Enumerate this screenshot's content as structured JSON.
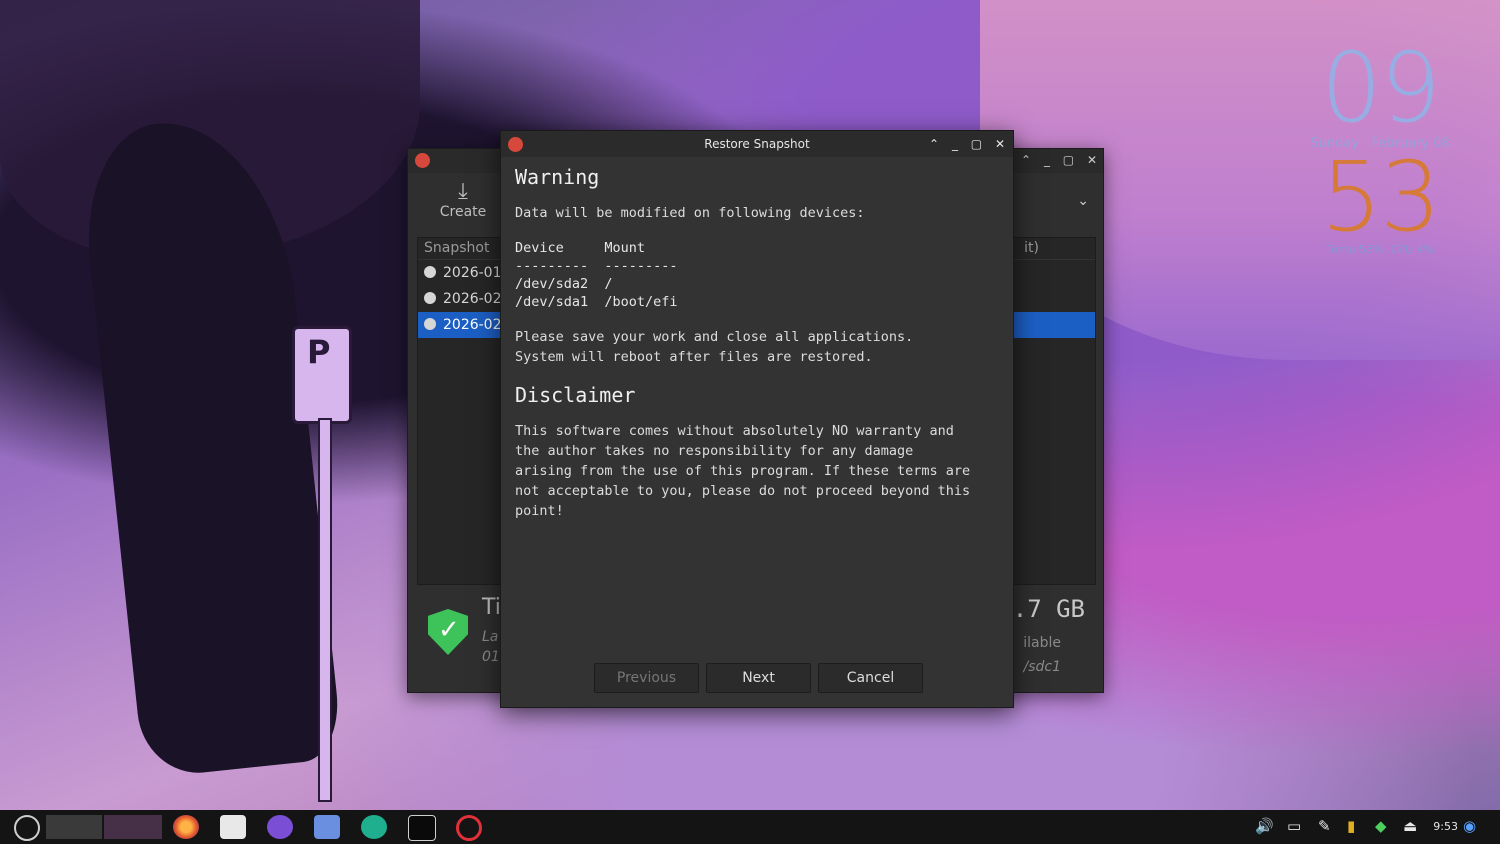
{
  "conky": {
    "hour": "09",
    "day": "Sunday",
    "date": "February 08",
    "minute": "53",
    "temp_label": "Temp 53%",
    "cpu_label": "CPU 4%"
  },
  "bg_window": {
    "create_label": "Create",
    "list_header": "Snapshot",
    "list_header_right": "it)",
    "rows": [
      "2026-01",
      "2026-02",
      "2026-02"
    ],
    "status_title": "Ti",
    "status_line1": "La",
    "status_line2": "01",
    "size_text": ".7 GB",
    "available_text": "ilable",
    "device_text": "/sdc1"
  },
  "dialog": {
    "title": "Restore Snapshot",
    "warning_heading": "Warning",
    "warning_intro": "Data will be modified on following devices:",
    "device_table": "Device     Mount\n---------  ---------\n/dev/sda2  /\n/dev/sda1  /boot/efi",
    "save_text": "Please save your work and close all applications.\nSystem will reboot after files are restored.",
    "disclaimer_heading": "Disclaimer",
    "disclaimer_text": "This software comes without absolutely NO warranty and\nthe author takes no responsibility for any damage\narising from the use of this program. If these terms are\nnot acceptable to you, please do not proceed beyond this\npoint!",
    "btn_previous": "Previous",
    "btn_next": "Next",
    "btn_cancel": "Cancel"
  },
  "taskbar": {
    "clock": "9:53"
  }
}
